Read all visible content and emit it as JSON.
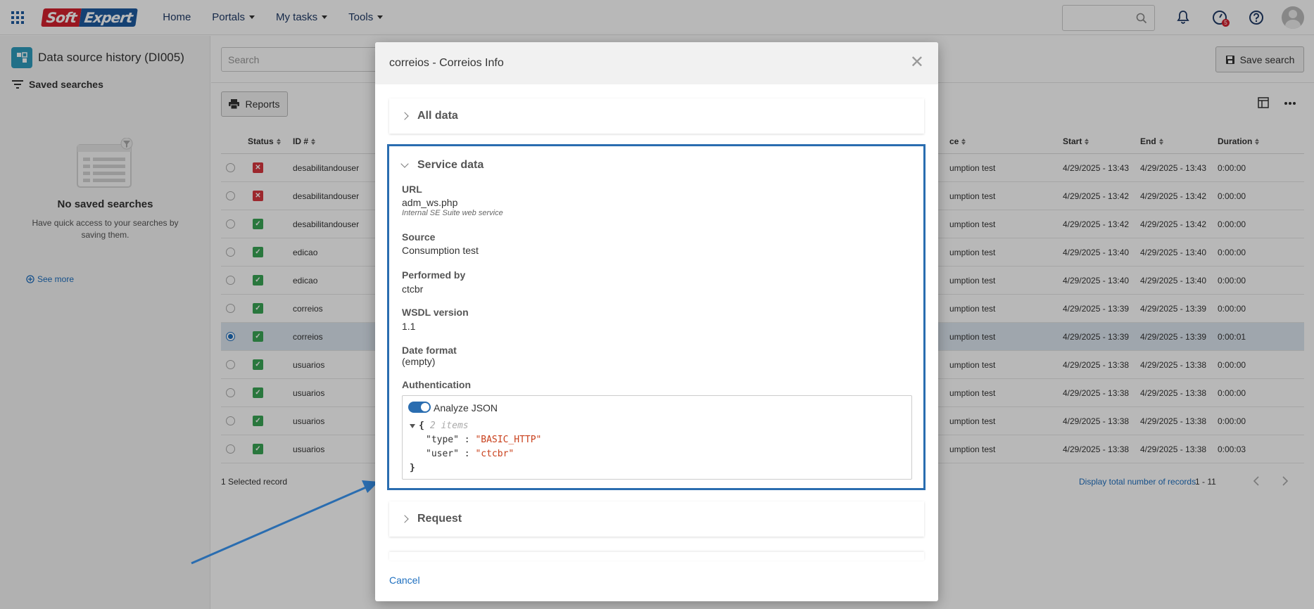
{
  "topbar": {
    "logo": {
      "part1": "Soft",
      "part2": "Expert"
    },
    "nav": [
      "Home",
      "Portals",
      "My tasks",
      "Tools"
    ],
    "notification_badge": "5"
  },
  "left_panel": {
    "title": "Data source history (DI005)",
    "saved_searches_label": "Saved searches",
    "empty_title": "No saved searches",
    "empty_text": "Have quick access to your searches by saving them.",
    "see_more": "See more"
  },
  "main": {
    "search_placeholder": "Search",
    "save_search_label": "Save search",
    "reports_label": "Reports",
    "columns": {
      "status": "Status",
      "id": "ID #",
      "source": "ce",
      "start": "Start",
      "end": "End",
      "duration": "Duration"
    },
    "rows": [
      {
        "status": "error",
        "id": "desabilitandouser",
        "source": "umption test",
        "start": "4/29/2025 - 13:43",
        "end": "4/29/2025 - 13:43",
        "duration": "0:00:00",
        "selected": false
      },
      {
        "status": "error",
        "id": "desabilitandouser",
        "source": "umption test",
        "start": "4/29/2025 - 13:42",
        "end": "4/29/2025 - 13:42",
        "duration": "0:00:00",
        "selected": false
      },
      {
        "status": "ok",
        "id": "desabilitandouser",
        "source": "umption test",
        "start": "4/29/2025 - 13:42",
        "end": "4/29/2025 - 13:42",
        "duration": "0:00:00",
        "selected": false
      },
      {
        "status": "ok",
        "id": "edicao",
        "source": "umption test",
        "start": "4/29/2025 - 13:40",
        "end": "4/29/2025 - 13:40",
        "duration": "0:00:00",
        "selected": false
      },
      {
        "status": "ok",
        "id": "edicao",
        "source": "umption test",
        "start": "4/29/2025 - 13:40",
        "end": "4/29/2025 - 13:40",
        "duration": "0:00:00",
        "selected": false
      },
      {
        "status": "ok",
        "id": "correios",
        "source": "umption test",
        "start": "4/29/2025 - 13:39",
        "end": "4/29/2025 - 13:39",
        "duration": "0:00:00",
        "selected": false
      },
      {
        "status": "ok",
        "id": "correios",
        "source": "umption test",
        "start": "4/29/2025 - 13:39",
        "end": "4/29/2025 - 13:39",
        "duration": "0:00:01",
        "selected": true
      },
      {
        "status": "ok",
        "id": "usuarios",
        "source": "umption test",
        "start": "4/29/2025 - 13:38",
        "end": "4/29/2025 - 13:38",
        "duration": "0:00:00",
        "selected": false
      },
      {
        "status": "ok",
        "id": "usuarios",
        "source": "umption test",
        "start": "4/29/2025 - 13:38",
        "end": "4/29/2025 - 13:38",
        "duration": "0:00:00",
        "selected": false
      },
      {
        "status": "ok",
        "id": "usuarios",
        "source": "umption test",
        "start": "4/29/2025 - 13:38",
        "end": "4/29/2025 - 13:38",
        "duration": "0:00:00",
        "selected": false
      },
      {
        "status": "ok",
        "id": "usuarios",
        "source": "umption test",
        "start": "4/29/2025 - 13:38",
        "end": "4/29/2025 - 13:38",
        "duration": "0:00:03",
        "selected": false
      }
    ],
    "footer": {
      "selected": "1 Selected record",
      "total_link": "Display total number of records",
      "range": "1 - 11"
    }
  },
  "modal": {
    "title": "correios - Correios Info",
    "sections": {
      "all_data": "All data",
      "service_data": "Service data",
      "request": "Request"
    },
    "fields": {
      "url_label": "URL",
      "url_value": "adm_ws.php",
      "url_hint": "Internal SE Suite web service",
      "source_label": "Source",
      "source_value": "Consumption test",
      "performed_label": "Performed by",
      "performed_value": "ctcbr",
      "wsdl_label": "WSDL version",
      "wsdl_value": "1.1",
      "date_label": "Date format",
      "date_value": "(empty)",
      "auth_label": "Authentication"
    },
    "json_viewer": {
      "toggle_label": "Analyze JSON",
      "open_brace": "{",
      "close_brace": "}",
      "item_count": "2 items",
      "entries": [
        {
          "key": "\"type\"",
          "value": "\"BASIC_HTTP\""
        },
        {
          "key": "\"user\"",
          "value": "\"ctcbr\""
        }
      ]
    },
    "cancel_label": "Cancel"
  },
  "colors": {
    "accent": "#2a6db0",
    "ok": "#3aa655",
    "error": "#d9373f",
    "link": "#1e6fbf"
  }
}
